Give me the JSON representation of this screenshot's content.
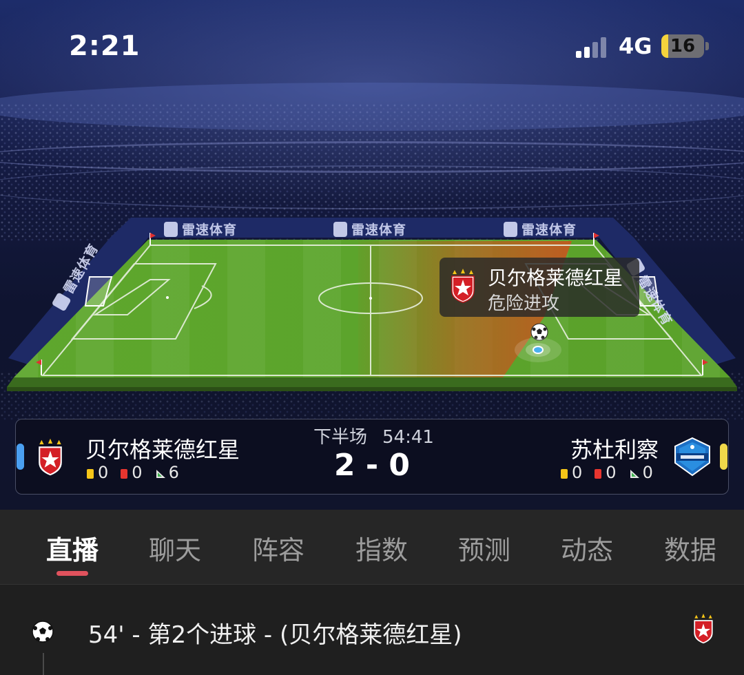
{
  "status_bar": {
    "time": "2:21",
    "network": "4G",
    "battery": "16"
  },
  "pitch": {
    "ad_text": "雷速体育",
    "attack_popup": {
      "team": "贝尔格莱德红星",
      "label": "危险进攻"
    }
  },
  "match": {
    "period": "下半场",
    "clock": "54:41",
    "score": "2 - 0",
    "home": {
      "name": "贝尔格莱德红星",
      "yellow": "0",
      "red": "0",
      "corners": "6",
      "tab_color": "#4a9ff0"
    },
    "away": {
      "name": "苏杜利察",
      "yellow": "0",
      "red": "0",
      "corners": "0",
      "tab_color": "#f0d84a"
    }
  },
  "tabs": [
    {
      "label": "直播",
      "active": true
    },
    {
      "label": "聊天"
    },
    {
      "label": "阵容"
    },
    {
      "label": "指数"
    },
    {
      "label": "预测"
    },
    {
      "label": "动态"
    },
    {
      "label": "数据"
    }
  ],
  "feed": [
    {
      "text": "54' - 第2个进球 - (贝尔格莱德红星)"
    }
  ],
  "colors": {
    "accent": "#e0525d",
    "pitch_green": "#5aa52c",
    "attack_overlay": "#c8541e"
  },
  "icons": [
    "signal-icon",
    "battery-icon",
    "soccer-ball-icon",
    "red-star-badge-icon",
    "radnik-badge-icon",
    "yellow-card-icon",
    "red-card-icon",
    "corner-flag-icon"
  ]
}
